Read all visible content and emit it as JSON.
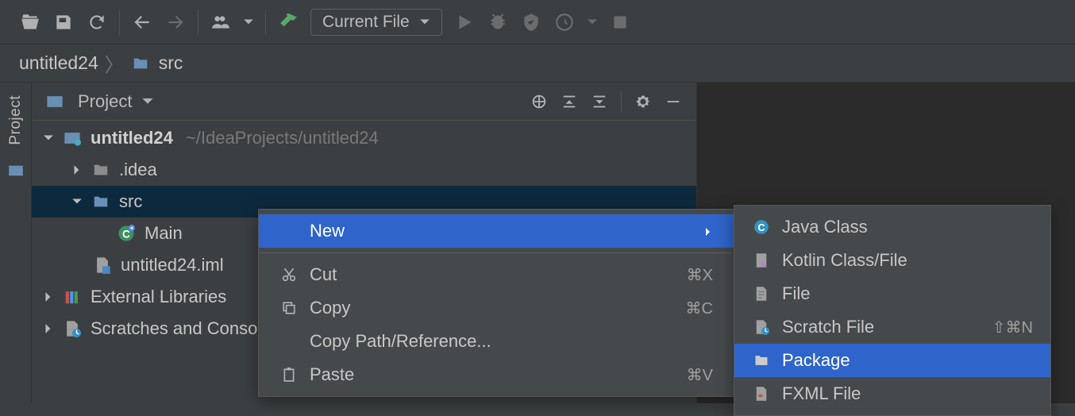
{
  "toolbar": {
    "run_config_label": "Current File"
  },
  "breadcrumb": {
    "root": "untitled24",
    "folder": "src"
  },
  "side_tab": {
    "project": "Project"
  },
  "panel": {
    "title": "Project"
  },
  "tree": {
    "project_name": "untitled24",
    "project_path": "~/IdeaProjects/untitled24",
    "idea": ".idea",
    "src": "src",
    "main": "Main",
    "iml": "untitled24.iml",
    "external_libs": "External Libraries",
    "scratches": "Scratches and Consoles"
  },
  "context_menu": {
    "new": "New",
    "cut": "Cut",
    "cut_shortcut": "⌘X",
    "copy": "Copy",
    "copy_shortcut": "⌘C",
    "copy_path": "Copy Path/Reference...",
    "paste": "Paste",
    "paste_shortcut": "⌘V"
  },
  "submenu": {
    "java_class": "Java Class",
    "kotlin": "Kotlin Class/File",
    "file": "File",
    "scratch": "Scratch File",
    "scratch_shortcut": "⇧⌘N",
    "package": "Package",
    "fxml": "FXML File"
  }
}
